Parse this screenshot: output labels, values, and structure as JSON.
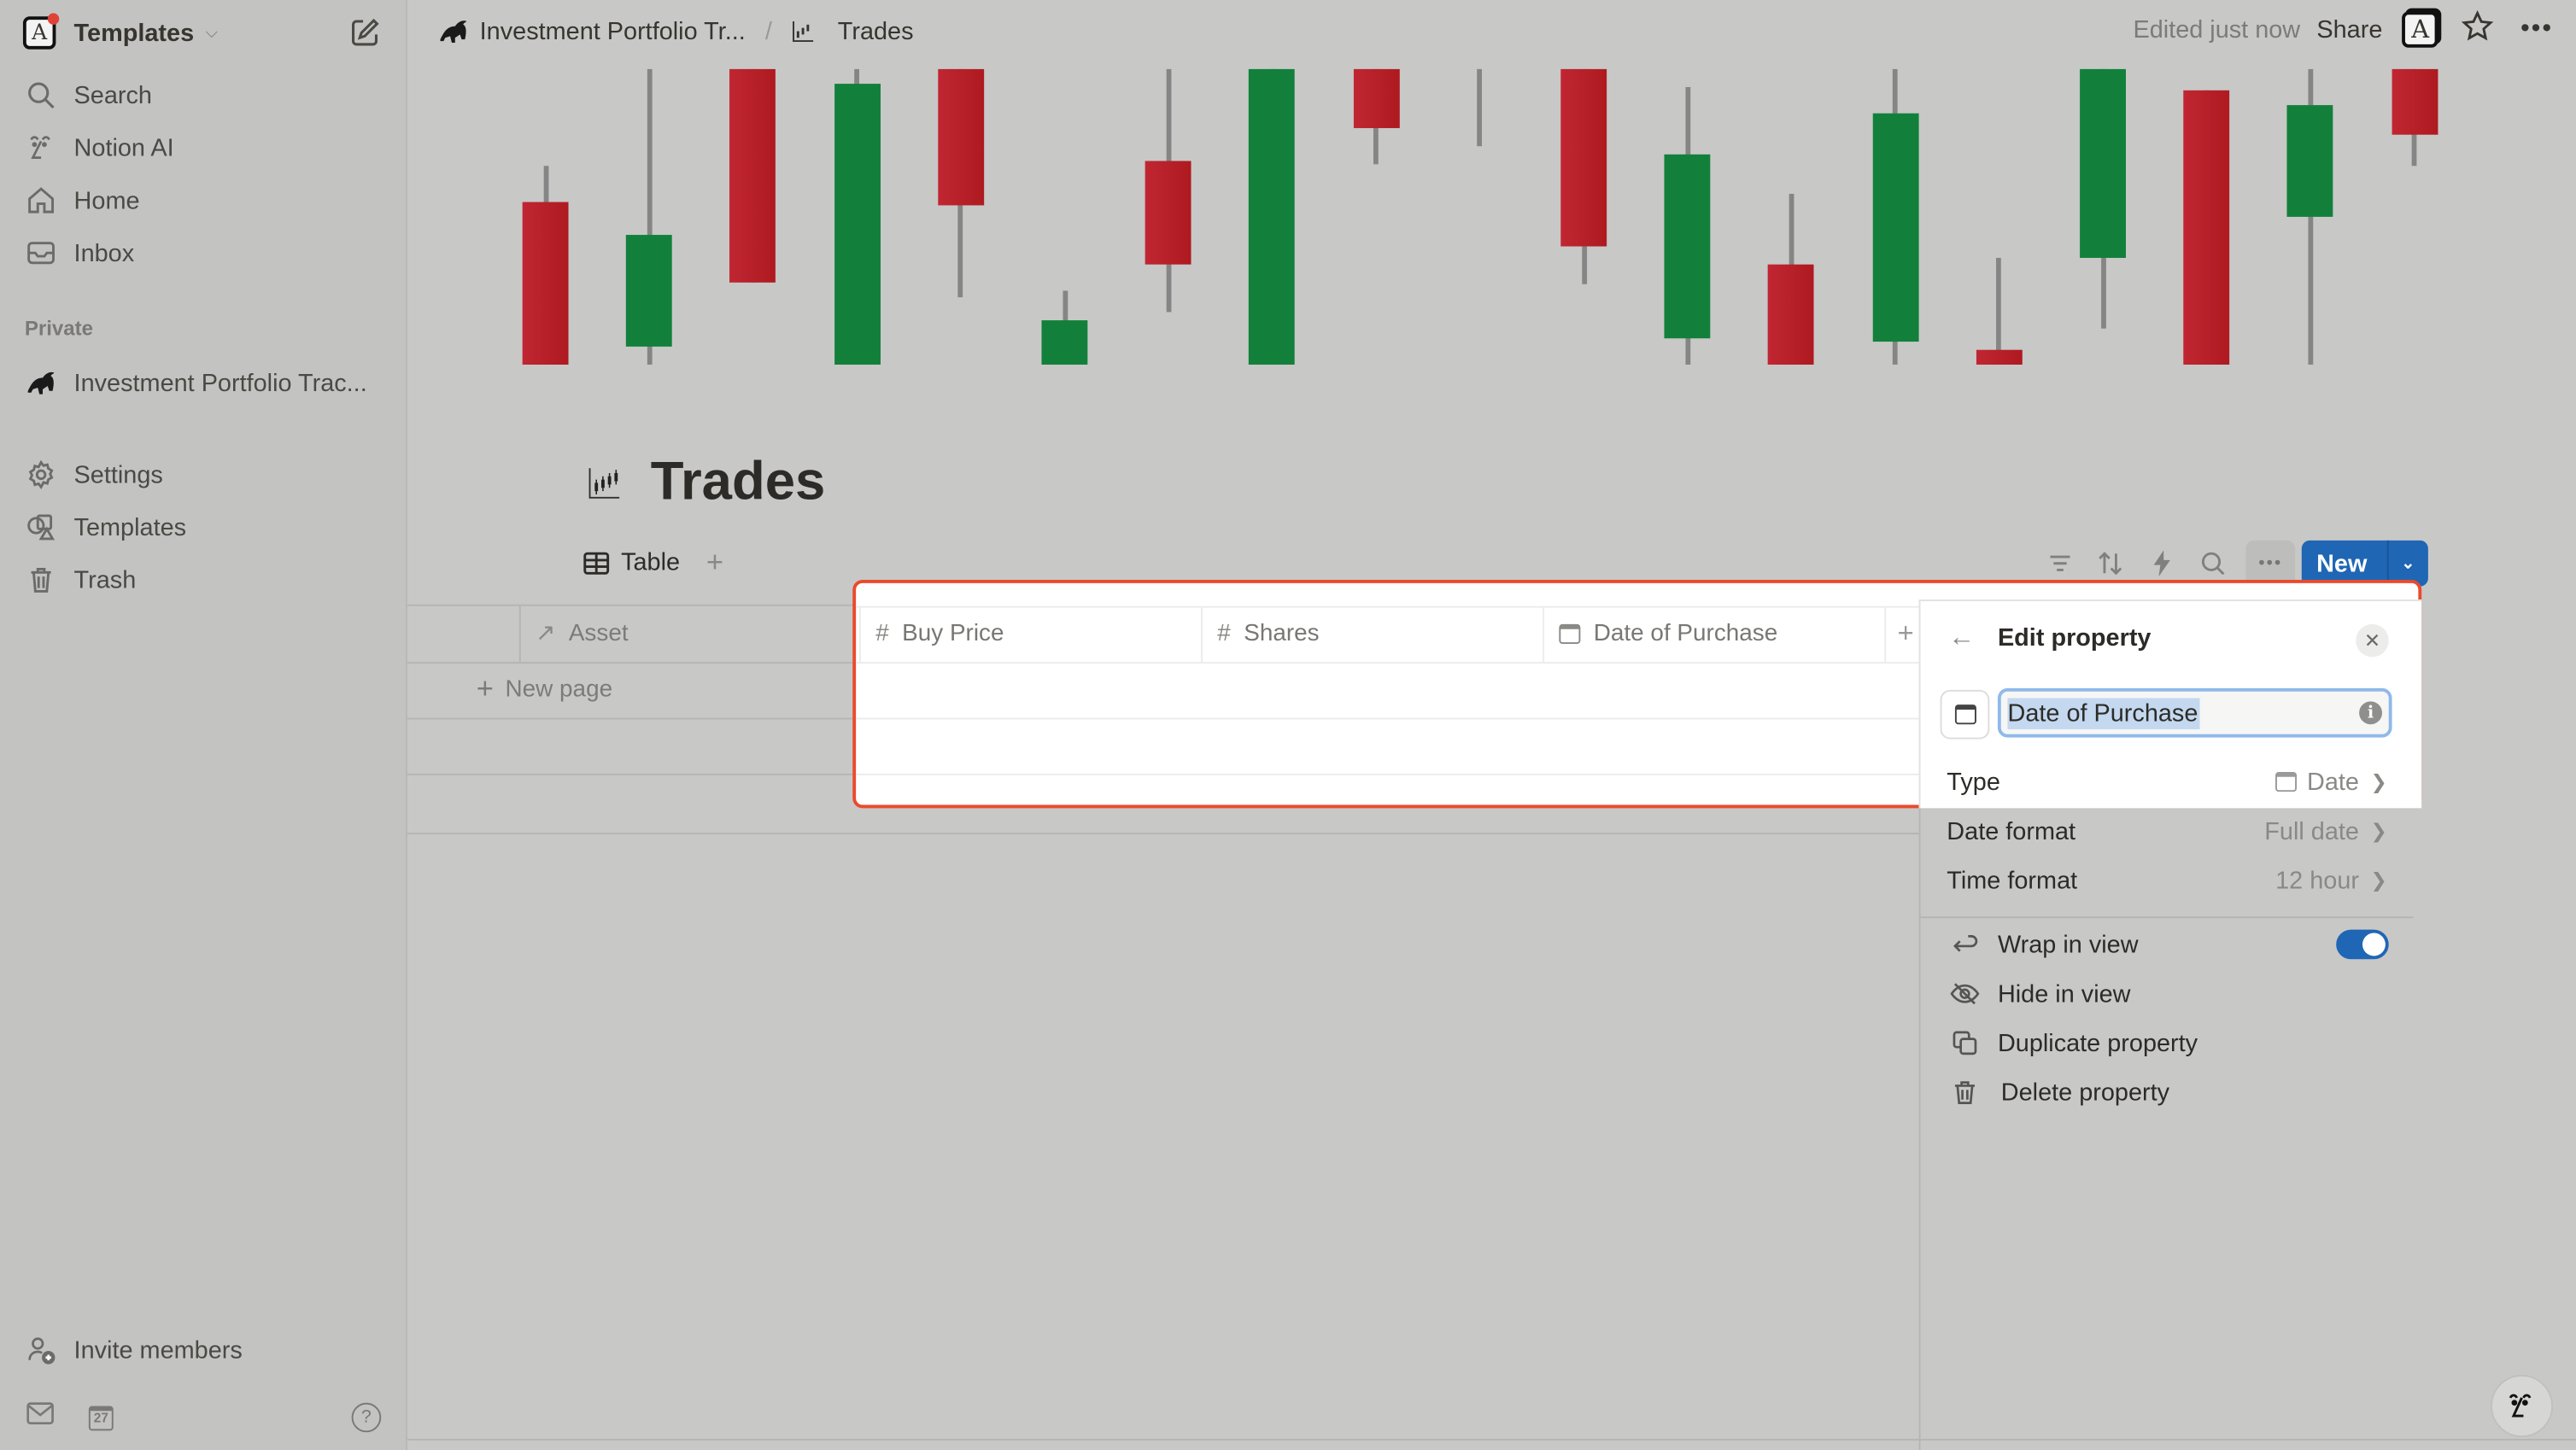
{
  "sidebar": {
    "workspace": {
      "name": "Templates",
      "logo_letter": "A"
    },
    "nav": [
      {
        "label": "Search",
        "icon": "search-icon"
      },
      {
        "label": "Notion AI",
        "icon": "notion-ai-icon"
      },
      {
        "label": "Home",
        "icon": "home-icon"
      },
      {
        "label": "Inbox",
        "icon": "inbox-icon"
      }
    ],
    "private_label": "Private",
    "private_pages": [
      {
        "label": "Investment Portfolio Trac...",
        "icon": "bull-icon"
      }
    ],
    "utility": [
      {
        "label": "Settings",
        "icon": "gear-icon"
      },
      {
        "label": "Templates",
        "icon": "templates-icon"
      },
      {
        "label": "Trash",
        "icon": "trash-icon"
      }
    ],
    "invite_label": "Invite members",
    "calendar_day": "27"
  },
  "topbar": {
    "breadcrumb": [
      {
        "label": "Investment Portfolio Tr...",
        "icon": "bull-icon"
      },
      {
        "label": "Trades",
        "icon": "candlestick-chart-icon"
      }
    ],
    "separator": "/",
    "edited": "Edited just now",
    "share": "Share",
    "avatar_letter": "A"
  },
  "page": {
    "title": "Trades",
    "view_tab": "Table",
    "toolbar": {
      "new_label": "New"
    }
  },
  "table": {
    "columns": [
      {
        "label": "Asset",
        "icon": "relation-arrow-icon"
      },
      {
        "label": "Buy Price",
        "icon": "number-icon"
      },
      {
        "label": "Shares",
        "icon": "number-icon"
      },
      {
        "label": "Date of Purchase",
        "icon": "calendar-icon"
      }
    ],
    "new_page_label": "New page",
    "number_glyph": "#",
    "add_glyph": "+"
  },
  "edit_property": {
    "title": "Edit property",
    "name_value": "Date of Purchase",
    "rows": [
      {
        "label": "Type",
        "value": "Date",
        "has_icon": true
      },
      {
        "label": "Date format",
        "value": "Full date"
      },
      {
        "label": "Time format",
        "value": "12 hour"
      }
    ],
    "actions": [
      {
        "label": "Wrap in view",
        "icon": "wrap-icon",
        "toggle": true
      },
      {
        "label": "Hide in view",
        "icon": "eye-off-icon"
      },
      {
        "label": "Duplicate property",
        "icon": "duplicate-icon"
      },
      {
        "label": "Delete property",
        "icon": "trash-icon"
      }
    ],
    "wrap_in_view_on": true
  },
  "colors": {
    "accent": "#1f66b5",
    "highlight_border": "#ea4a2c",
    "candle_red": "#b81f27",
    "candle_green": "#12803a"
  },
  "cover_candles": [
    {
      "color": "red",
      "wick": [
        0.67,
        0.0
      ],
      "body": [
        0.55,
        0.0
      ]
    },
    {
      "color": "green",
      "wick": [
        1.0,
        0.0
      ],
      "body": [
        0.44,
        0.06
      ]
    },
    {
      "color": "red",
      "wick": [
        1.0,
        0.28
      ],
      "body": [
        1.0,
        0.28
      ]
    },
    {
      "color": "green",
      "wick": [
        1.0,
        0.0
      ],
      "body": [
        0.95,
        0.0
      ]
    },
    {
      "color": "red",
      "wick": [
        1.0,
        0.23
      ],
      "body": [
        1.0,
        0.54
      ]
    },
    {
      "color": "green",
      "wick": [
        0.25,
        0.0
      ],
      "body": [
        0.15,
        0.0
      ]
    },
    {
      "color": "red",
      "wick": [
        1.0,
        0.18
      ],
      "body": [
        0.69,
        0.34
      ]
    },
    {
      "color": "green",
      "wick": [
        1.0,
        0.0
      ],
      "body": [
        1.0,
        0.0
      ]
    },
    {
      "color": "red",
      "wick": [
        1.0,
        0.68
      ],
      "body": [
        1.0,
        0.8
      ]
    },
    {
      "color": "grey",
      "wick": [
        1.0,
        0.74
      ],
      "body": [
        0,
        0
      ]
    },
    {
      "color": "red",
      "wick": [
        1.0,
        0.27
      ],
      "body": [
        1.0,
        0.4
      ]
    },
    {
      "color": "green",
      "wick": [
        0.94,
        0.0
      ],
      "body": [
        0.71,
        0.09
      ]
    },
    {
      "color": "red",
      "wick": [
        0.58,
        0.0
      ],
      "body": [
        0.34,
        0.0
      ]
    },
    {
      "color": "green",
      "wick": [
        1.0,
        0.0
      ],
      "body": [
        0.85,
        0.08
      ]
    },
    {
      "color": "red",
      "wick": [
        0.36,
        0.0
      ],
      "body": [
        0.05,
        0.0
      ]
    },
    {
      "color": "green",
      "wick": [
        1.0,
        0.12
      ],
      "body": [
        1.0,
        0.36
      ]
    },
    {
      "color": "red",
      "wick": [
        0.93,
        0.0
      ],
      "body": [
        0.93,
        0.0
      ]
    },
    {
      "color": "green",
      "wick": [
        1.0,
        0.0
      ],
      "body": [
        0.88,
        0.5
      ]
    },
    {
      "color": "red",
      "wick": [
        1.0,
        0.67
      ],
      "body": [
        1.0,
        0.78
      ]
    }
  ]
}
